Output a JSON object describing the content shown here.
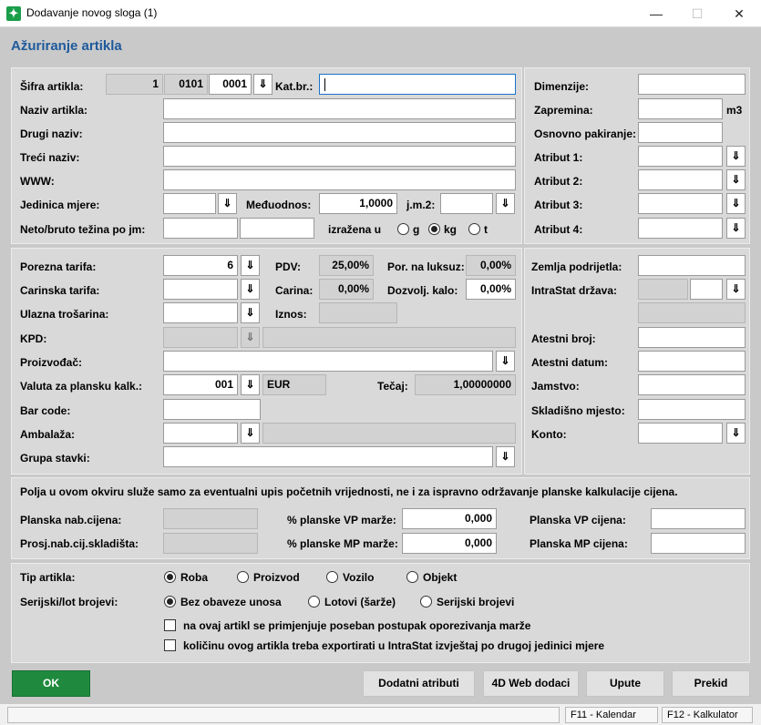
{
  "window": {
    "title": "Dodavanje novog sloga (1)",
    "min": "—",
    "max": "☐",
    "close": "✕"
  },
  "heading": "Ažuriranje artikla",
  "dd_glyph": "⇓",
  "top_left": {
    "sifra_label": "Šifra artikla:",
    "sifra_1": "1",
    "sifra_2": "0101",
    "sifra_3": "0001",
    "katbr_label": "Kat.br.:",
    "katbr_value": "",
    "naziv_label": "Naziv artikla:",
    "drugi_label": "Drugi naziv:",
    "treci_label": "Treći naziv:",
    "www_label": "WWW:",
    "jm_label": "Jedinica mjere:",
    "medjuodnos_label": "Međuodnos:",
    "medjuodnos_value": "1,0000",
    "jm2_label": "j.m.2:",
    "neto_label": "Neto/bruto težina po jm:",
    "izrazena_label": "izražena u",
    "unit_g": "g",
    "unit_kg": "kg",
    "unit_t": "t"
  },
  "top_right": {
    "dimenzije_label": "Dimenzije:",
    "zapremina_label": "Zapremina:",
    "zapremina_unit": "m3",
    "pakiranje_label": "Osnovno pakiranje:",
    "atribut1_label": "Atribut 1:",
    "atribut2_label": "Atribut 2:",
    "atribut3_label": "Atribut 3:",
    "atribut4_label": "Atribut 4:"
  },
  "mid_left": {
    "porezna_label": "Porezna tarifa:",
    "porezna_value": "6",
    "pdv_label": "PDV:",
    "pdv_value": "25,00%",
    "luksuz_label": "Por. na luksuz:",
    "luksuz_value": "0,00%",
    "carinska_label": "Carinska tarifa:",
    "carina_label": "Carina:",
    "carina_value": "0,00%",
    "kalo_label": "Dozvolj. kalo:",
    "kalo_value": "0,00%",
    "trosarina_label": "Ulazna trošarina:",
    "iznos_label": "Iznos:",
    "kpd_label": "KPD:",
    "proizvodjac_label": "Proizvođač:",
    "valuta_label": "Valuta za plansku kalk.:",
    "valuta_value": "001",
    "valuta_name": "EUR",
    "tecaj_label": "Tečaj:",
    "tecaj_value": "1,00000000",
    "barcode_label": "Bar code:",
    "ambalaza_label": "Ambalaža:",
    "grupa_label": "Grupa stavki:"
  },
  "mid_right": {
    "zemlja_label": "Zemlja podrijetla:",
    "intrastat_label": "IntraStat država:",
    "atestni_broj_label": "Atestni broj:",
    "atestni_datum_label": "Atestni datum:",
    "jamstvo_label": "Jamstvo:",
    "skladisno_label": "Skladišno mjesto:",
    "konto_label": "Konto:"
  },
  "pricing": {
    "note": "Polja u ovom okviru služe samo za eventualni upis početnih vrijednosti, ne i za ispravno održavanje planske kalkulacije cijena.",
    "nab_label": "Planska nab.cijena:",
    "prosj_label": "Prosj.nab.cij.skladišta:",
    "vp_marza_label": "% planske VP marže:",
    "vp_marza_value": "0,000",
    "mp_marza_label": "% planske MP marže:",
    "mp_marza_value": "0,000",
    "vp_cijena_label": "Planska VP cijena:",
    "mp_cijena_label": "Planska MP cijena:"
  },
  "type": {
    "tip_label": "Tip artikla:",
    "tip_options": [
      "Roba",
      "Proizvod",
      "Vozilo",
      "Objekt"
    ],
    "serijski_label": "Serijski/lot brojevi:",
    "serijski_options": [
      "Bez obaveze unosa",
      "Lotovi (šarže)",
      "Serijski brojevi"
    ],
    "check1": "na ovaj artikl se primjenjuje poseban postupak oporezivanja marže",
    "check2": "količinu ovog artikla treba exportirati u IntraStat izvještaj po drugoj jedinici mjere"
  },
  "buttons": {
    "ok": "OK",
    "dodatni": "Dodatni atributi",
    "web": "4D Web dodaci",
    "upute": "Upute",
    "prekid": "Prekid"
  },
  "status": {
    "f11": "F11 - Kalendar",
    "f12": "F12 - Kalkulator"
  }
}
